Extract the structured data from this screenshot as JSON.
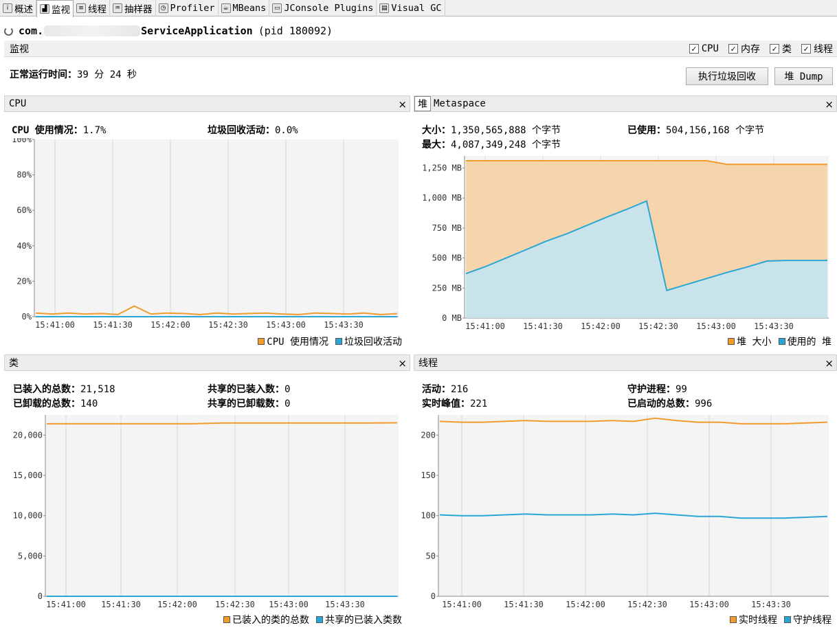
{
  "tabs": [
    {
      "label": "概述",
      "icon": "overview-icon"
    },
    {
      "label": "监视",
      "icon": "monitor-icon",
      "active": true
    },
    {
      "label": "线程",
      "icon": "threads-icon"
    },
    {
      "label": "抽样器",
      "icon": "sampler-icon"
    },
    {
      "label": "Profiler",
      "icon": "profiler-icon"
    },
    {
      "label": "MBeans",
      "icon": "mbeans-icon"
    },
    {
      "label": "JConsole Plugins",
      "icon": "jconsole-icon"
    },
    {
      "label": "Visual GC",
      "icon": "visualgc-icon"
    }
  ],
  "app": {
    "prefix": "com.",
    "suffix": "ServiceApplication",
    "pid": "(pid 180092)"
  },
  "monitor": {
    "label": "监视",
    "checks": [
      {
        "label": "CPU",
        "checked": true
      },
      {
        "label": "内存",
        "checked": true
      },
      {
        "label": "类",
        "checked": true
      },
      {
        "label": "线程",
        "checked": true
      }
    ]
  },
  "uptime": {
    "label": "正常运行时间：",
    "value": "39 分 24 秒"
  },
  "buttons": {
    "gc": "执行垃圾回收",
    "heap_dump": "堆 Dump"
  },
  "cpu": {
    "title": "CPU",
    "usage_label": "CPU 使用情况：",
    "usage_value": "1.7%",
    "gc_label": "垃圾回收活动：",
    "gc_value": "0.0%",
    "legend": [
      "CPU 使用情况",
      "垃圾回收活动"
    ]
  },
  "heap": {
    "tab_heap": "堆",
    "tab_meta": "Metaspace",
    "size_label": "大小：",
    "size_value": "1,350,565,888 个字节",
    "max_label": "最大：",
    "max_value": "4,087,349,248 个字节",
    "used_label": "已使用：",
    "used_value": "504,156,168 个字节",
    "legend": [
      "堆 大小",
      "使用的 堆"
    ]
  },
  "classes": {
    "title": "类",
    "loaded_label": "已装入的总数：",
    "loaded_value": "21,518",
    "unloaded_label": "已卸载的总数：",
    "unloaded_value": "140",
    "shared_loaded_label": "共享的已装入数：",
    "shared_loaded_value": "0",
    "shared_unloaded_label": "共享的已卸载数：",
    "shared_unloaded_value": "0",
    "legend": [
      "已装入的类的总数",
      "共享的已装入类数"
    ]
  },
  "threads": {
    "title": "线程",
    "live_label": "活动：",
    "live_value": "216",
    "peak_label": "实时峰值：",
    "peak_value": "221",
    "daemon_label": "守护进程：",
    "daemon_value": "99",
    "started_label": "已启动的总数：",
    "started_value": "996",
    "legend": [
      "实时线程",
      "守护线程"
    ]
  },
  "colors": {
    "orange": "#f29b2b",
    "blue": "#2aa6d6",
    "orange_fill": "#f6cfa0",
    "blue_fill": "#bfe6f5"
  },
  "chart_data": [
    {
      "type": "line",
      "title": "CPU",
      "x": [
        "15:41:00",
        "15:41:30",
        "15:42:00",
        "15:42:30",
        "15:43:00",
        "15:43:30"
      ],
      "ylim": [
        0,
        100
      ],
      "yticks": [
        "0%",
        "20%",
        "40%",
        "60%",
        "80%",
        "100%"
      ],
      "series": [
        {
          "name": "CPU 使用情况",
          "values": [
            2,
            1.5,
            2,
            1.5,
            1.8,
            1.2,
            6,
            1.5,
            2,
            1.8,
            1.2,
            2,
            1.5,
            1.8,
            2,
            1.5,
            1.2,
            2,
            1.8,
            1.5,
            2,
            1.2,
            1.7
          ]
        },
        {
          "name": "垃圾回收活动",
          "values": [
            0,
            0,
            0,
            0,
            0,
            0,
            0,
            0,
            0,
            0,
            0,
            0,
            0,
            0,
            0,
            0,
            0,
            0,
            0,
            0,
            0,
            0,
            0
          ]
        }
      ]
    },
    {
      "type": "area",
      "title": "堆",
      "x": [
        "15:41:00",
        "15:41:30",
        "15:42:00",
        "15:42:30",
        "15:43:00",
        "15:43:30"
      ],
      "ylim": [
        0,
        1350
      ],
      "yticks": [
        "0 MB",
        "250 MB",
        "500 MB",
        "750 MB",
        "1,000 MB",
        "1,250 MB"
      ],
      "series": [
        {
          "name": "堆 大小",
          "values": [
            1310,
            1310,
            1310,
            1310,
            1310,
            1310,
            1310,
            1310,
            1310,
            1310,
            1310,
            1310,
            1310,
            1280,
            1280,
            1280,
            1280,
            1280,
            1280
          ]
        },
        {
          "name": "使用的 堆",
          "values": [
            370,
            430,
            500,
            570,
            640,
            700,
            770,
            840,
            905,
            975,
            230,
            280,
            330,
            380,
            425,
            475,
            480,
            480,
            480
          ]
        }
      ]
    },
    {
      "type": "line",
      "title": "类",
      "x": [
        "15:41:00",
        "15:41:30",
        "15:42:00",
        "15:42:30",
        "15:43:00",
        "15:43:30"
      ],
      "ylim": [
        0,
        22500
      ],
      "yticks": [
        "0",
        "5,000",
        "10,000",
        "15,000",
        "20,000"
      ],
      "series": [
        {
          "name": "已装入的类的总数",
          "values": [
            21400,
            21400,
            21400,
            21400,
            21400,
            21400,
            21500,
            21500,
            21500,
            21500,
            21500,
            21500,
            21518
          ]
        },
        {
          "name": "共享的已装入类数",
          "values": [
            0,
            0,
            0,
            0,
            0,
            0,
            0,
            0,
            0,
            0,
            0,
            0,
            0
          ]
        }
      ]
    },
    {
      "type": "line",
      "title": "线程",
      "x": [
        "15:41:00",
        "15:41:30",
        "15:42:00",
        "15:42:30",
        "15:43:00",
        "15:43:30"
      ],
      "ylim": [
        0,
        225
      ],
      "yticks": [
        "0",
        "50",
        "100",
        "150",
        "200"
      ],
      "series": [
        {
          "name": "实时线程",
          "values": [
            217,
            216,
            216,
            217,
            218,
            217,
            217,
            217,
            218,
            217,
            221,
            218,
            216,
            216,
            214,
            214,
            214,
            215,
            216
          ]
        },
        {
          "name": "守护线程",
          "values": [
            101,
            100,
            100,
            101,
            102,
            101,
            101,
            101,
            102,
            101,
            103,
            101,
            99,
            99,
            97,
            97,
            97,
            98,
            99
          ]
        }
      ]
    }
  ]
}
